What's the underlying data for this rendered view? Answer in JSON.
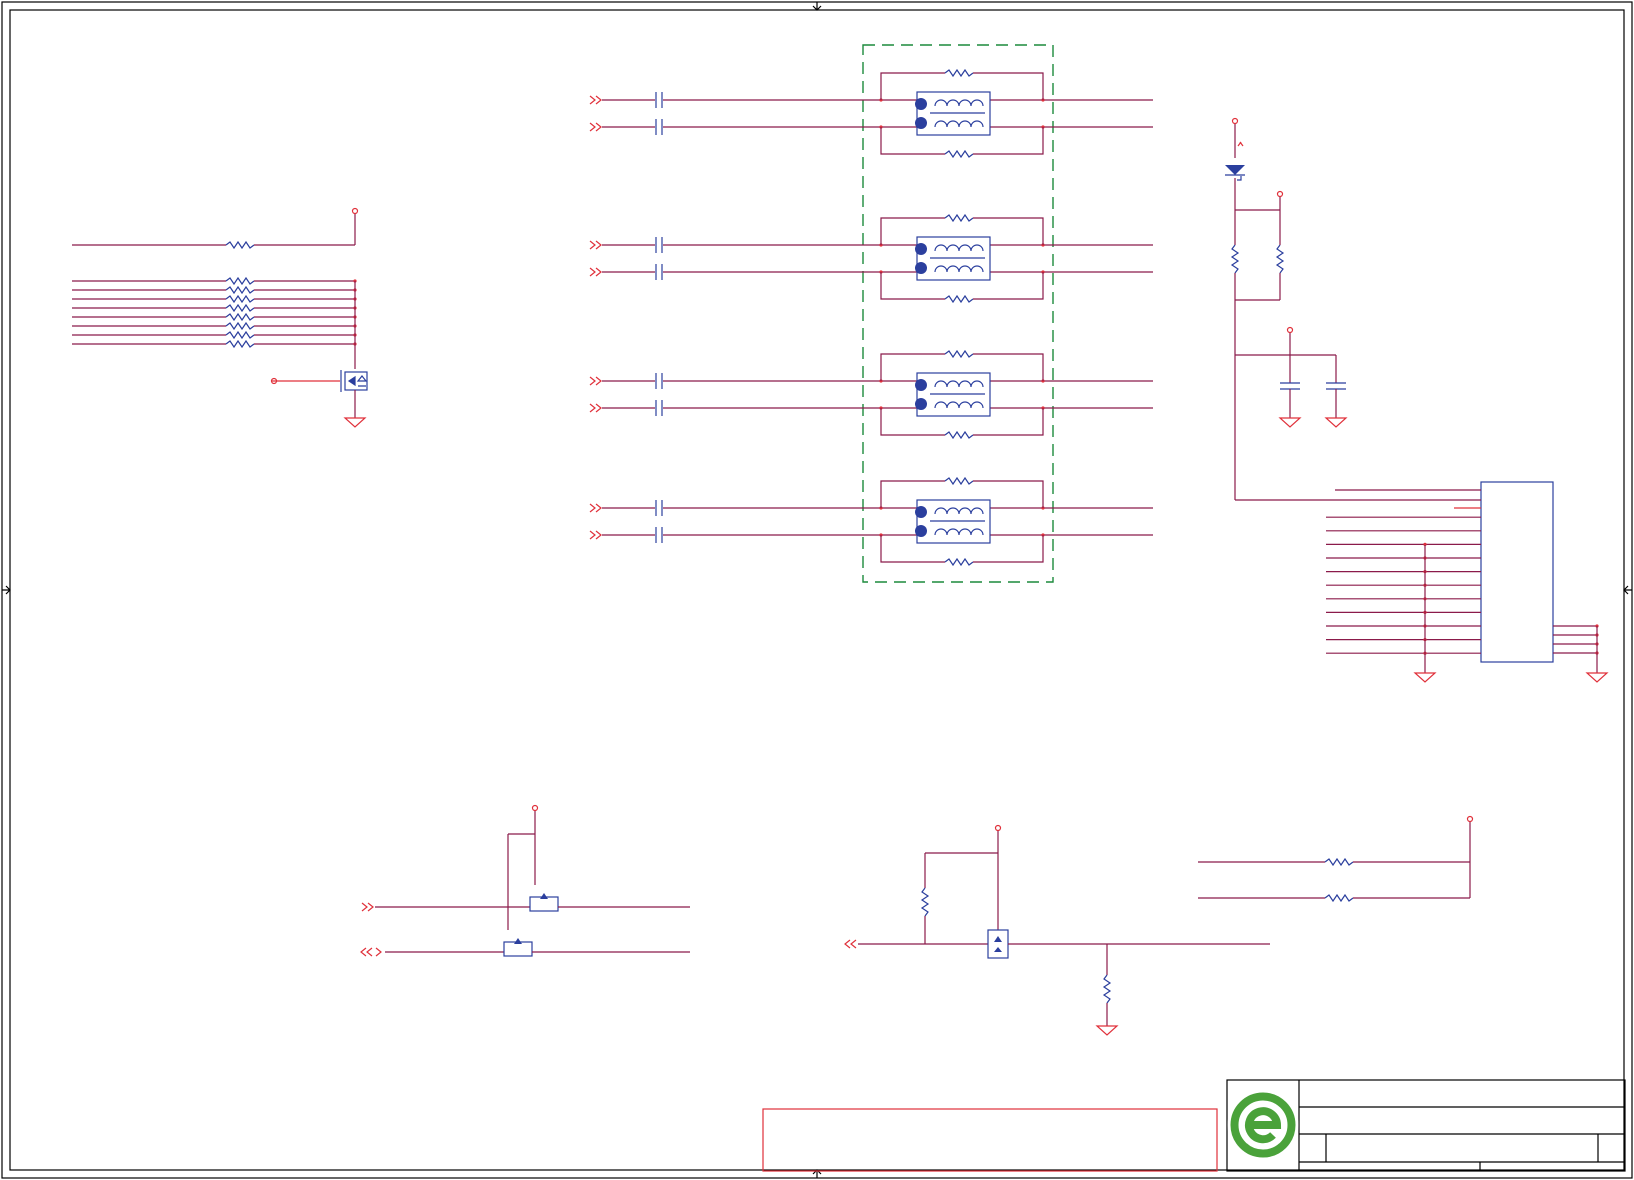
{
  "diagram": {
    "type": "electrical-schematic-sheet",
    "colors": {
      "wire": "#8b1a4a",
      "pin": "#e0303a",
      "component": "#2b3f9e",
      "group_outline": "#1c8a3c",
      "frame": "#000000",
      "logo": "#4aa23a"
    },
    "blocks": [
      {
        "name": "resistor-pullup-array",
        "resistor_count": 9,
        "symbols": [
          "resistor",
          "power-port",
          "mosfet",
          "ground"
        ]
      },
      {
        "name": "ethernet-magnetics",
        "channels": 4,
        "symbols": [
          "offpage-connector",
          "capacitor",
          "transformer",
          "resistor"
        ]
      },
      {
        "name": "led-supply",
        "symbols": [
          "power-port",
          "led",
          "resistor",
          "capacitor",
          "ground"
        ]
      },
      {
        "name": "connector-header",
        "pin_rows": 13,
        "symbols": [
          "connector",
          "ground"
        ]
      },
      {
        "name": "level-shifter",
        "symbols": [
          "offpage-connector",
          "mosfet",
          "power-port"
        ]
      },
      {
        "name": "switch-circuit",
        "symbols": [
          "offpage-connector",
          "mosfet",
          "resistor",
          "ground"
        ]
      },
      {
        "name": "pullup-pair",
        "resistor_count": 2,
        "symbols": [
          "resistor",
          "power-port"
        ]
      }
    ],
    "title_block": {
      "logo_icon": "green-e-logo-icon"
    }
  }
}
